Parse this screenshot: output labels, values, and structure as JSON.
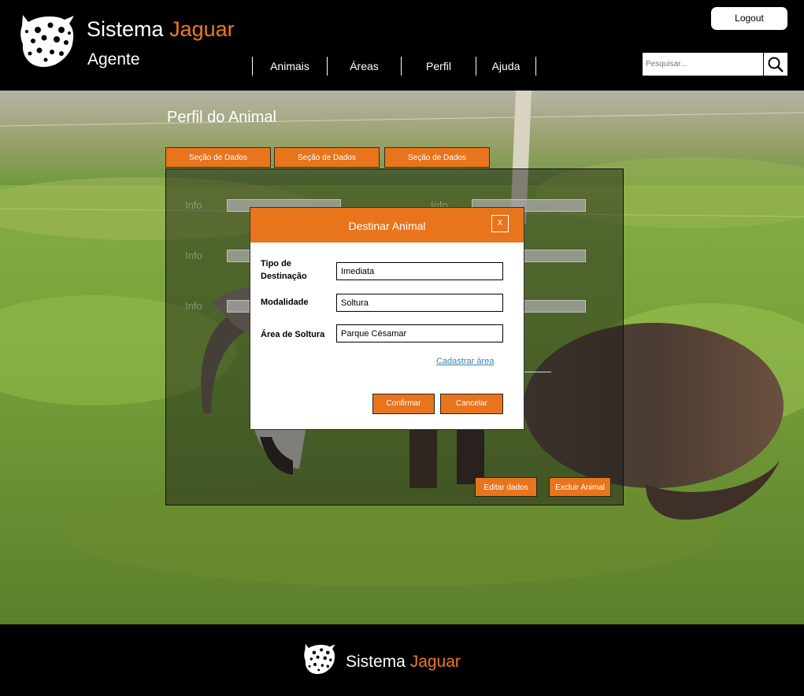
{
  "brand": {
    "name": "Sistema",
    "accent": "Jaguar",
    "role": "Agente",
    "accent_color": "#e8741c"
  },
  "header": {
    "logout_label": "Logout",
    "search": {
      "placeholder": "Pesquisar..."
    },
    "nav": [
      "Animais",
      "Áreas",
      "Perfil",
      "Ajuda"
    ]
  },
  "page": {
    "title": "Perfil do Animal",
    "tabs": [
      "Seção de Dados",
      "Seção de Dados",
      "Seção de Dados"
    ],
    "info_label": "Info",
    "edit_button": "Editar dados",
    "delete_button": "Excluir Animal"
  },
  "modal": {
    "title": "Destinar Animal",
    "close_label": "X",
    "fields": [
      {
        "label": "Tipo de Destinação",
        "value": "Imediata"
      },
      {
        "label": "Modalidade",
        "value": "Soltura"
      },
      {
        "label": "Área de Soltura",
        "value": "Parque Césamar"
      }
    ],
    "link": "Cadastrar área",
    "confirm": "Confirmar",
    "cancel": "Cancelar"
  },
  "footer": {
    "name": "Sistema",
    "accent": "Jaguar"
  },
  "icons": {
    "logo": "jaguar-head-logo-icon",
    "search": "search-icon"
  }
}
